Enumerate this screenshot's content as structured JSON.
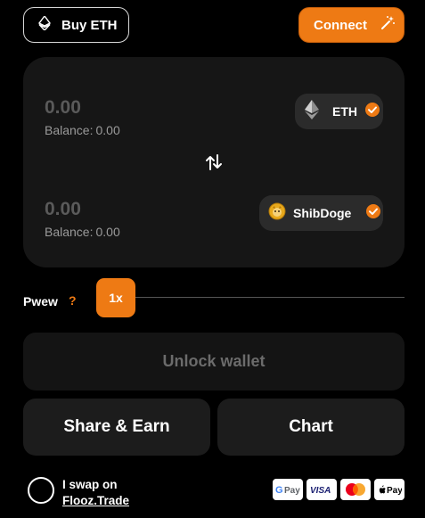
{
  "header": {
    "buy_label": "Buy ETH",
    "buy_icon": "ethereum-icon",
    "connect_label": "Connect",
    "connect_icon": "magic-wand-icon",
    "accent_color": "#ee7a14"
  },
  "swap": {
    "from": {
      "amount": "0.00",
      "balance_label": "Balance:",
      "balance_value": "0.00",
      "token": "ETH",
      "token_icon": "ethereum-icon",
      "verified_icon": "verified-badge-icon"
    },
    "to": {
      "amount": "0.00",
      "balance_label": "Balance:",
      "balance_value": "0.00",
      "token": "ShibDoge",
      "token_icon": "shibdoge-coin-icon",
      "verified_icon": "verified-badge-icon"
    },
    "switch_icon": "swap-arrows-icon"
  },
  "slippage": {
    "label": "Pwew",
    "help": "?",
    "value": "1x"
  },
  "unlock": {
    "label": "Unlock wallet"
  },
  "actions": {
    "share_label": "Share & Earn",
    "chart_label": "Chart"
  },
  "footer": {
    "line1": "I swap on",
    "line2": "Flooz.Trade",
    "payments": [
      {
        "name": "G Pay",
        "icon": "google-pay-icon"
      },
      {
        "name": "VISA",
        "icon": "visa-icon"
      },
      {
        "name": "mastercard",
        "icon": "mastercard-icon"
      },
      {
        "name": "Pay",
        "icon": "apple-pay-icon"
      }
    ]
  }
}
